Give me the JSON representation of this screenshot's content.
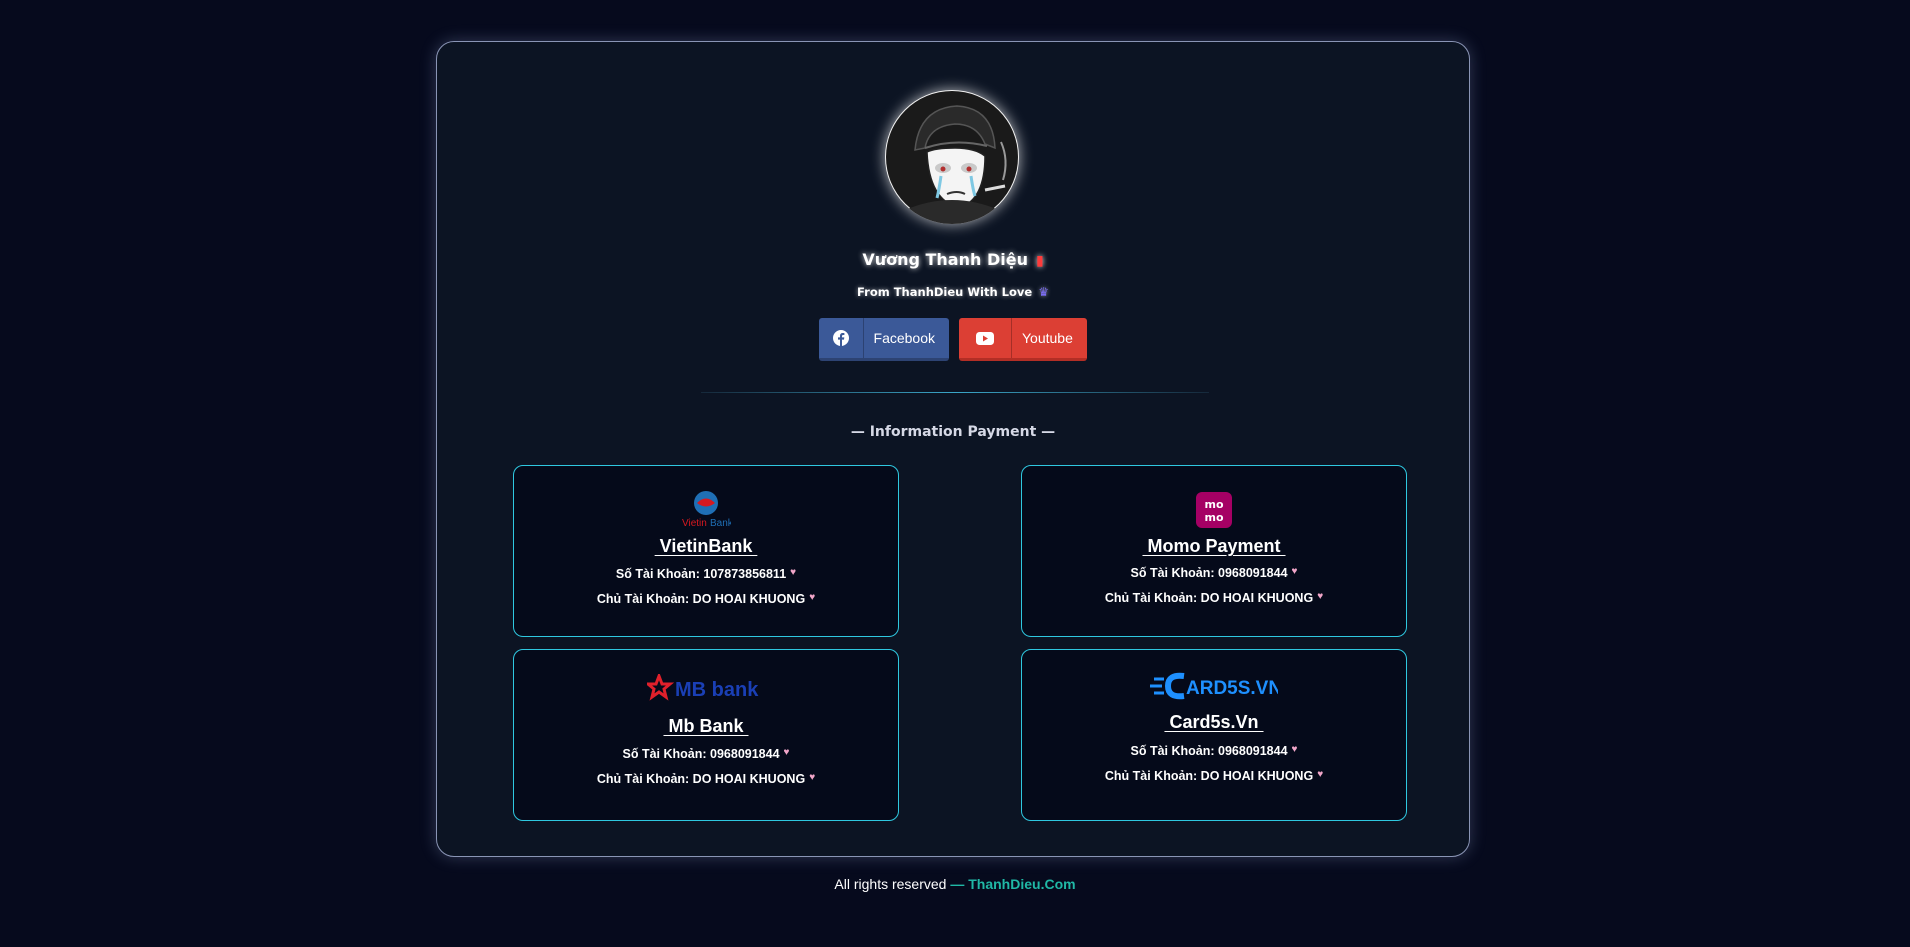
{
  "profile": {
    "name": "Vương Thanh Diệu",
    "name_badge_icon": "fire-extinguisher-icon",
    "tagline": "From ThanhDieu With Love",
    "tagline_icon": "crown-icon"
  },
  "social": {
    "facebook_label": "Facebook",
    "facebook_icon": "facebook-icon",
    "facebook_color": "#3b5998",
    "youtube_label": "Youtube",
    "youtube_icon": "youtube-icon",
    "youtube_color": "#dc3f34"
  },
  "section": {
    "title": "— Information Payment —"
  },
  "payments": [
    {
      "logo": "vietinbank-logo",
      "logo_text": "VietinBank",
      "name": " VietinBank ",
      "account_line": "Số Tài Khoản: 107873856811",
      "owner_line": "Chủ Tài Khoản: DO HOAI KHUONG"
    },
    {
      "logo": "momo-logo",
      "logo_text": "mo mo",
      "name": " Momo Payment ",
      "account_line": "Số Tài Khoản: 0968091844",
      "owner_line": "Chủ Tài Khoản: DO HOAI KHUONG"
    },
    {
      "logo": "mbbank-logo",
      "logo_text": "MB bank",
      "name": " Mb Bank ",
      "account_line": "Số Tài Khoản: 0968091844",
      "owner_line": "Chủ Tài Khoản: DO HOAI KHUONG"
    },
    {
      "logo": "card5s-logo",
      "logo_text": "CARD5S.VN",
      "name": " Card5s.Vn ",
      "account_line": "Số Tài Khoản: 0968091844",
      "owner_line": "Chủ Tài Khoản: DO HOAI KHUONG"
    }
  ],
  "footer": {
    "text": "All rights reserved ",
    "brand": "— ThanhDieu.Com"
  },
  "colors": {
    "background": "#060a1d",
    "card_border": "#2fc8e0",
    "brand_accent": "#20b8a6"
  }
}
